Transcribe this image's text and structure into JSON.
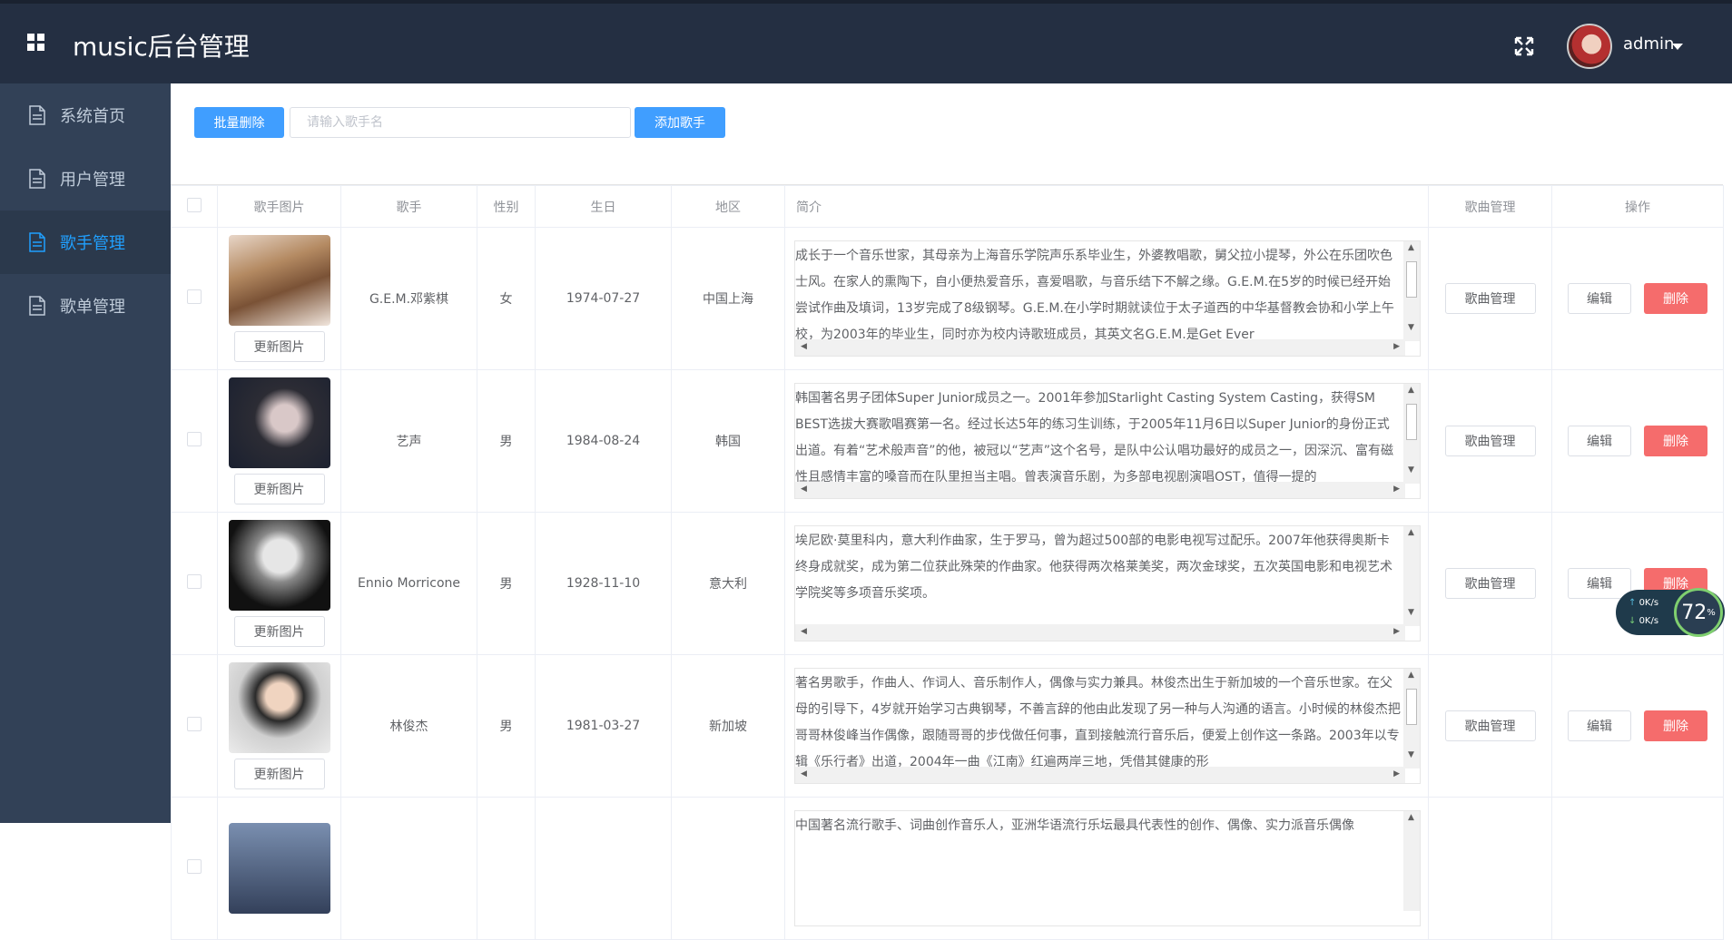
{
  "header": {
    "title": "music后台管理",
    "username": "admin",
    "grid_icon": "apps-grid-icon",
    "fullscreen_icon": "fullscreen-icon"
  },
  "sidebar": {
    "items": [
      {
        "label": "系统首页",
        "icon": "document-icon",
        "active": false
      },
      {
        "label": "用户管理",
        "icon": "document-icon",
        "active": false
      },
      {
        "label": "歌手管理",
        "icon": "document-icon",
        "active": true
      },
      {
        "label": "歌单管理",
        "icon": "document-icon",
        "active": false
      }
    ]
  },
  "toolbar": {
    "batch_delete_label": "批量删除",
    "search_placeholder": "请输入歌手名",
    "add_singer_label": "添加歌手"
  },
  "table": {
    "headers": [
      "歌手图片",
      "歌手",
      "性别",
      "生日",
      "地区",
      "简介",
      "歌曲管理",
      "操作"
    ],
    "update_pic_label": "更新图片",
    "song_manage_label": "歌曲管理",
    "edit_label": "编辑",
    "delete_label": "删除",
    "rows": [
      {
        "name": "G.E.M.邓紫棋",
        "gender": "女",
        "birthday": "1974-07-27",
        "region": "中国上海",
        "intro": "成长于一个音乐世家，其母亲为上海音乐学院声乐系毕业生，外婆教唱歌，舅父拉小提琴，外公在乐团吹色士风。在家人的熏陶下，自小便热爱音乐，喜爱唱歌，与音乐结下不解之缘。G.E.M.在5岁的时候已经开始尝试作曲及填词，13岁完成了8级钢琴。G.E.M.在小学时期就读位于太子道西的中华基督教会协和小学上午校，为2003年的毕业生，同时亦为校内诗歌班成员，其英文名G.E.M.是Get Ever"
      },
      {
        "name": "艺声",
        "gender": "男",
        "birthday": "1984-08-24",
        "region": "韩国",
        "intro": "韩国著名男子团体Super Junior成员之一。2001年参加Starlight Casting System Casting，获得SM BEST选拔大赛歌唱赛第一名。经过长达5年的练习生训练，于2005年11月6日以Super Junior的身份正式出道。有着“艺术般声音”的他，被冠以“艺声”这个名号，是队中公认唱功最好的成员之一，因深沉、富有磁性且感情丰富的嗓音而在队里担当主唱。曾表演音乐剧，为多部电视剧演唱OST，值得一提的"
      },
      {
        "name": "Ennio Morricone",
        "gender": "男",
        "birthday": "1928-11-10",
        "region": "意大利",
        "intro": "埃尼欧·莫里科内，意大利作曲家，生于罗马，曾为超过500部的电影电视写过配乐。2007年他获得奥斯卡终身成就奖，成为第二位获此殊荣的作曲家。他获得两次格莱美奖，两次金球奖，五次英国电影和电视艺术学院奖等多项音乐奖项。"
      },
      {
        "name": "林俊杰",
        "gender": "男",
        "birthday": "1981-03-27",
        "region": "新加坡",
        "intro": "著名男歌手，作曲人、作词人、音乐制作人，偶像与实力兼具。林俊杰出生于新加坡的一个音乐世家。在父母的引导下，4岁就开始学习古典钢琴，不善言辞的他由此发现了另一种与人沟通的语言。小时候的林俊杰把哥哥林俊峰当作偶像，跟随哥哥的步伐做任何事，直到接触流行音乐后，便爱上创作这一条路。2003年以专辑《乐行者》出道，2004年一曲《江南》红遍两岸三地，凭借其健康的形"
      },
      {
        "name": "",
        "gender": "",
        "birthday": "",
        "region": "",
        "intro": "中国著名流行歌手、词曲创作音乐人，亚洲华语流行乐坛最具代表性的创作、偶像、实力派音乐偶像"
      }
    ]
  },
  "widget": {
    "up_speed": "0K/s",
    "down_speed": "0K/s",
    "percent": "72",
    "percent_unit": "%"
  },
  "colors": {
    "header_bg": "#242f42",
    "sidebar_bg": "#324157",
    "active": "#20a0ff",
    "primary": "#409eff",
    "danger": "#f56c6c"
  }
}
